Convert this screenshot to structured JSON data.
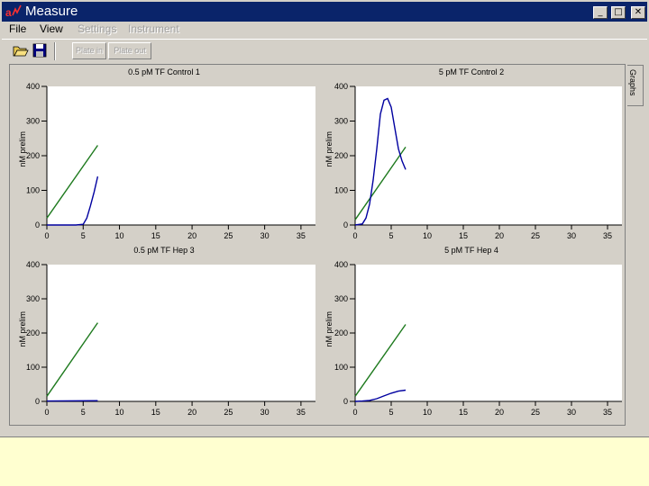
{
  "window": {
    "title": "Measure",
    "controls": {
      "minimize": "_",
      "maximize": "□",
      "close": "✕"
    }
  },
  "menu": [
    {
      "label": "File",
      "enabled": true
    },
    {
      "label": "View",
      "enabled": true
    },
    {
      "label": "Settings",
      "enabled": false
    },
    {
      "label": "Instrument",
      "enabled": false
    }
  ],
  "toolbar": {
    "open_icon": "folder-open-icon",
    "save_icon": "floppy-disk-icon",
    "plate_in": "Plate in",
    "plate_out": "Plate out"
  },
  "side_tab": {
    "label": "Graphs"
  },
  "colors": {
    "series_green": "#1e7a1e",
    "series_blue": "#0000a0",
    "title_bar": "#0a246a",
    "background": "#ffffd0"
  },
  "chart_data": [
    {
      "type": "line",
      "title": "0.5 pM TF Control 1",
      "ylabel": "nM prelim",
      "xlim": [
        0,
        37
      ],
      "ylim": [
        0,
        400
      ],
      "xticks": [
        0,
        5,
        10,
        15,
        20,
        25,
        30,
        35
      ],
      "yticks": [
        0,
        100,
        200,
        300,
        400
      ],
      "series": [
        {
          "color": "#1e7a1e",
          "x": [
            0,
            7
          ],
          "y": [
            20,
            230
          ]
        },
        {
          "color": "#0000a0",
          "x": [
            0,
            2,
            4,
            5,
            5.5,
            6,
            6.5,
            7
          ],
          "y": [
            0,
            0,
            0,
            2,
            20,
            55,
            95,
            140
          ]
        }
      ]
    },
    {
      "type": "line",
      "title": "5 pM TF Control 2",
      "ylabel": "nM prelim",
      "xlim": [
        0,
        37
      ],
      "ylim": [
        0,
        400
      ],
      "xticks": [
        0,
        5,
        10,
        15,
        20,
        25,
        30,
        35
      ],
      "yticks": [
        0,
        100,
        200,
        300,
        400
      ],
      "series": [
        {
          "color": "#1e7a1e",
          "x": [
            0,
            7
          ],
          "y": [
            15,
            225
          ]
        },
        {
          "color": "#0000a0",
          "x": [
            0,
            1,
            1.5,
            2,
            2.5,
            3,
            3.5,
            4,
            4.5,
            5,
            5.5,
            6,
            6.5,
            7
          ],
          "y": [
            0,
            3,
            20,
            60,
            130,
            220,
            320,
            360,
            365,
            340,
            280,
            220,
            185,
            160
          ]
        }
      ]
    },
    {
      "type": "line",
      "title": "0.5 pM TF Hep 3",
      "ylabel": "nM prelim",
      "xlim": [
        0,
        37
      ],
      "ylim": [
        0,
        400
      ],
      "xticks": [
        0,
        5,
        10,
        15,
        20,
        25,
        30,
        35
      ],
      "yticks": [
        0,
        100,
        200,
        300,
        400
      ],
      "series": [
        {
          "color": "#1e7a1e",
          "x": [
            0,
            7
          ],
          "y": [
            15,
            230
          ]
        },
        {
          "color": "#0000a0",
          "x": [
            0,
            7
          ],
          "y": [
            1,
            2
          ]
        }
      ]
    },
    {
      "type": "line",
      "title": "5 pM TF Hep 4",
      "ylabel": "nM prelim",
      "xlim": [
        0,
        37
      ],
      "ylim": [
        0,
        400
      ],
      "xticks": [
        0,
        5,
        10,
        15,
        20,
        25,
        30,
        35
      ],
      "yticks": [
        0,
        100,
        200,
        300,
        400
      ],
      "series": [
        {
          "color": "#1e7a1e",
          "x": [
            0,
            7
          ],
          "y": [
            15,
            225
          ]
        },
        {
          "color": "#0000a0",
          "x": [
            0,
            1,
            2,
            3,
            4,
            5,
            6,
            7
          ],
          "y": [
            0,
            1,
            3,
            8,
            16,
            24,
            30,
            33
          ]
        }
      ]
    }
  ]
}
